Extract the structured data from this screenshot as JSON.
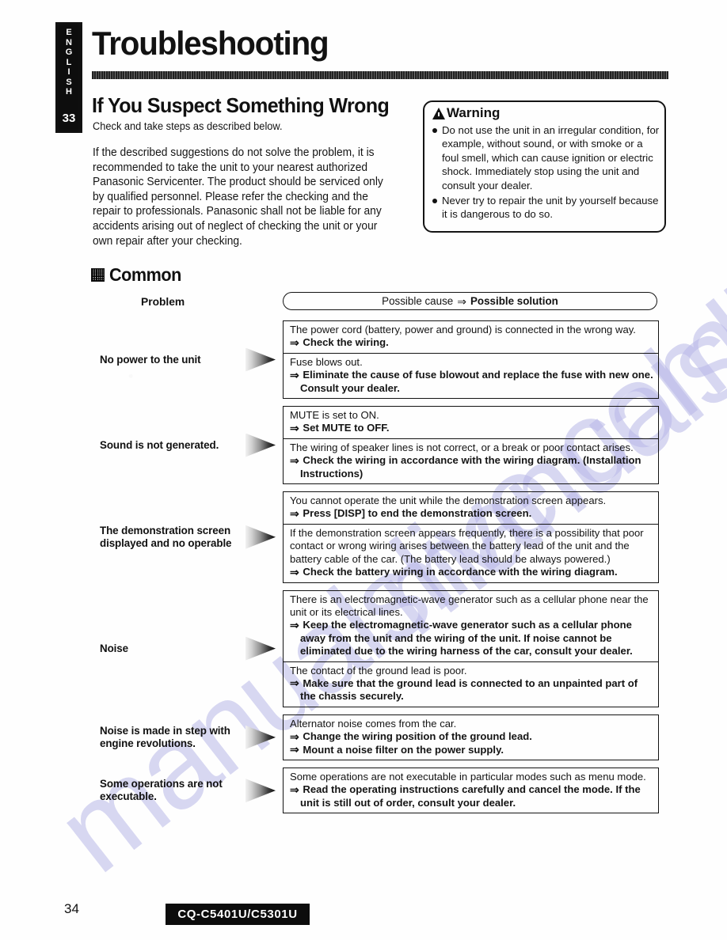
{
  "sidebar": {
    "language_letters": [
      "E",
      "N",
      "G",
      "L",
      "I",
      "S",
      "H"
    ],
    "language_label": "ENGLISH",
    "page_marker": "33"
  },
  "header": {
    "title": "Troubleshooting",
    "section_title": "If You Suspect Something Wrong",
    "section_subtitle": "Check and take steps as described below.",
    "intro_paragraph": "If the described suggestions do not solve the problem, it is recommended to take the unit to your nearest authorized Panasonic Servicenter. The product should be serviced only by qualified personnel. Please refer the checking and the repair to professionals. Panasonic shall not be liable for any accidents arising out of neglect of checking the unit or your own repair after your checking."
  },
  "warning": {
    "title": "Warning",
    "icon": "warning-triangle-icon",
    "items": [
      "Do not use the unit in an irregular condition, for example, without sound, or with smoke or a foul smell, which can cause ignition or electric shock. Immediately stop using the unit and consult your dealer.",
      "Never try to repair the unit by yourself because it is dangerous to do so."
    ]
  },
  "common_section": {
    "heading": "Common",
    "columns": {
      "problem": "Problem",
      "cause": "Possible cause",
      "arrow": "⇒",
      "solution": "Possible solution"
    },
    "rows": [
      {
        "problem": "No power to the unit",
        "cells": [
          {
            "cause": "The power cord (battery, power and ground) is connected in the wrong way.",
            "solutions": [
              "Check the wiring."
            ]
          },
          {
            "cause": "Fuse blows out.",
            "solutions": [
              "Eliminate the cause of fuse blowout and replace the fuse with new one. Consult your dealer."
            ]
          }
        ]
      },
      {
        "problem": "Sound is not generated.",
        "cells": [
          {
            "cause": "MUTE is set to ON.",
            "solutions": [
              "Set MUTE to OFF."
            ]
          },
          {
            "cause": "The wiring of speaker lines is not correct, or a break or poor contact arises.",
            "solutions": [
              "Check the wiring in accordance with the wiring diagram. (Installation Instructions)"
            ]
          }
        ]
      },
      {
        "problem": "The demonstration screen displayed and no operable",
        "cells": [
          {
            "cause": "You cannot operate the unit while the demonstration screen appears.",
            "solutions": [
              "Press [DISP] to end the demonstration screen."
            ]
          },
          {
            "cause": "If the demonstration screen appears frequently, there is a possibility that poor contact or wrong wiring arises between the battery lead of the unit and the battery cable of the car. (The battery lead should be always powered.)",
            "solutions": [
              "Check the battery wiring in accordance with the wiring diagram."
            ]
          }
        ]
      },
      {
        "problem": "Noise",
        "cells": [
          {
            "cause": "There is an electromagnetic-wave generator such as a cellular phone near the unit or its electrical lines.",
            "solutions": [
              "Keep the electromagnetic-wave generator such as a cellular phone away from the unit and the wiring of the unit. If noise cannot be eliminated due to the wiring harness of the car, consult your dealer."
            ]
          },
          {
            "cause": "The contact of the ground lead is poor.",
            "solutions": [
              "Make sure that the ground lead is connected to an unpainted part of the chassis securely."
            ]
          }
        ]
      },
      {
        "problem": "Noise is made in step with engine revolutions.",
        "cells": [
          {
            "cause": "Alternator noise comes from the car.",
            "solutions": [
              "Change the wiring position of the ground lead.",
              "Mount a noise filter on the power supply."
            ]
          }
        ]
      },
      {
        "problem": "Some operations are not executable.",
        "cells": [
          {
            "cause": "Some operations are not executable in particular modes such as menu mode.",
            "solutions": [
              "Read the operating instructions carefully and cancel the mode. If the unit is still out of order, consult your dealer."
            ]
          }
        ]
      }
    ]
  },
  "footer": {
    "page_number": "34",
    "model": "CQ-C5401U/C5301U"
  },
  "watermark": {
    "text": "manualslive.com",
    "color": "#b9b8e8"
  }
}
